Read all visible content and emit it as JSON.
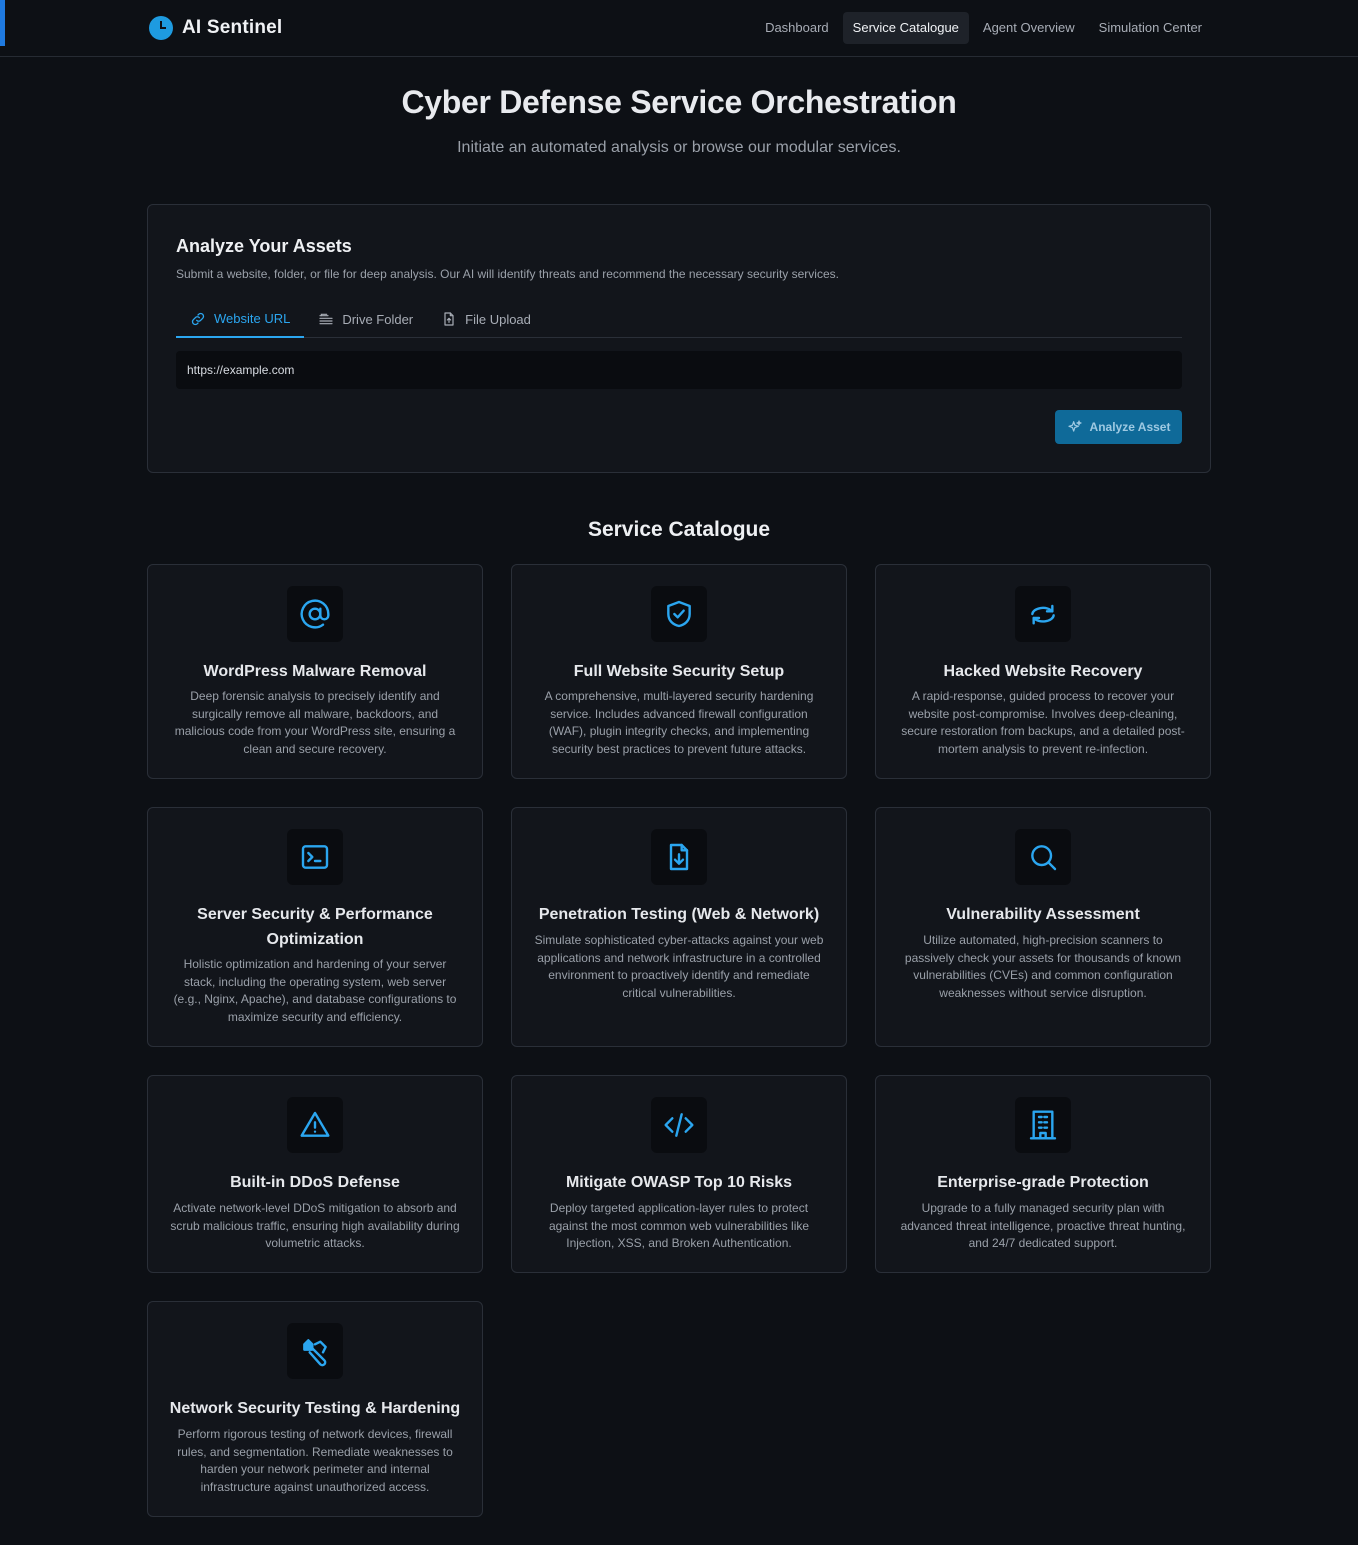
{
  "brand": {
    "name": "AI Sentinel",
    "logo_icon": "clock-icon"
  },
  "nav": [
    {
      "label": "Dashboard",
      "active": false
    },
    {
      "label": "Service Catalogue",
      "active": true
    },
    {
      "label": "Agent Overview",
      "active": false
    },
    {
      "label": "Simulation Center",
      "active": false
    }
  ],
  "hero": {
    "title": "Cyber Defense Service Orchestration",
    "subtitle": "Initiate an automated analysis or browse our modular services."
  },
  "analyze": {
    "title": "Analyze Your Assets",
    "description": "Submit a website, folder, or file for deep analysis. Our AI will identify threats and recommend the necessary security services.",
    "tabs": [
      {
        "label": "Website URL",
        "icon": "link-icon",
        "active": true
      },
      {
        "label": "Drive Folder",
        "icon": "drive-icon",
        "active": false
      },
      {
        "label": "File Upload",
        "icon": "file-upload-icon",
        "active": false
      }
    ],
    "input_value": "https://example.com",
    "button_label": "Analyze Asset",
    "button_icon": "sparkles-icon"
  },
  "catalogue": {
    "title": "Service Catalogue",
    "services": [
      {
        "title": "WordPress Malware Removal",
        "icon": "at-sign-icon",
        "description": "Deep forensic analysis to precisely identify and surgically remove all malware, backdoors, and malicious code from your WordPress site, ensuring a clean and secure recovery."
      },
      {
        "title": "Full Website Security Setup",
        "icon": "shield-check-icon",
        "description": "A comprehensive, multi-layered security hardening service. Includes advanced firewall configuration (WAF), plugin integrity checks, and implementing security best practices to prevent future attacks."
      },
      {
        "title": "Hacked Website Recovery",
        "icon": "refresh-icon",
        "description": "A rapid-response, guided process to recover your website post-compromise. Involves deep-cleaning, secure restoration from backups, and a detailed post-mortem analysis to prevent re-infection."
      },
      {
        "title": "Server Security & Performance Optimization",
        "icon": "terminal-icon",
        "description": "Holistic optimization and hardening of your server stack, including the operating system, web server (e.g., Nginx, Apache), and database configurations to maximize security and efficiency."
      },
      {
        "title": "Penetration Testing (Web & Network)",
        "icon": "file-download-icon",
        "description": "Simulate sophisticated cyber-attacks against your web applications and network infrastructure in a controlled environment to proactively identify and remediate critical vulnerabilities."
      },
      {
        "title": "Vulnerability Assessment",
        "icon": "search-icon",
        "description": "Utilize automated, high-precision scanners to passively check your assets for thousands of known vulnerabilities (CVEs) and common configuration weaknesses without service disruption."
      },
      {
        "title": "Built-in DDoS Defense",
        "icon": "warning-triangle-icon",
        "description": "Activate network-level DDoS mitigation to absorb and scrub malicious traffic, ensuring high availability during volumetric attacks."
      },
      {
        "title": "Mitigate OWASP Top 10 Risks",
        "icon": "code-icon",
        "description": "Deploy targeted application-layer rules to protect against the most common web vulnerabilities like Injection, XSS, and Broken Authentication."
      },
      {
        "title": "Enterprise-grade Protection",
        "icon": "building-icon",
        "description": "Upgrade to a fully managed security plan with advanced threat intelligence, proactive threat hunting, and 24/7 dedicated support."
      },
      {
        "title": "Network Security Testing & Hardening",
        "icon": "network-tools-icon",
        "description": "Perform rigorous testing of network devices, firewall rules, and segmentation. Remediate weaknesses to harden your network perimeter and internal infrastructure against unauthorized access."
      }
    ]
  },
  "colors": {
    "accent": "#2ba6f0",
    "background": "#0d1015",
    "card": "#12151b",
    "button": "#0f6a99"
  }
}
